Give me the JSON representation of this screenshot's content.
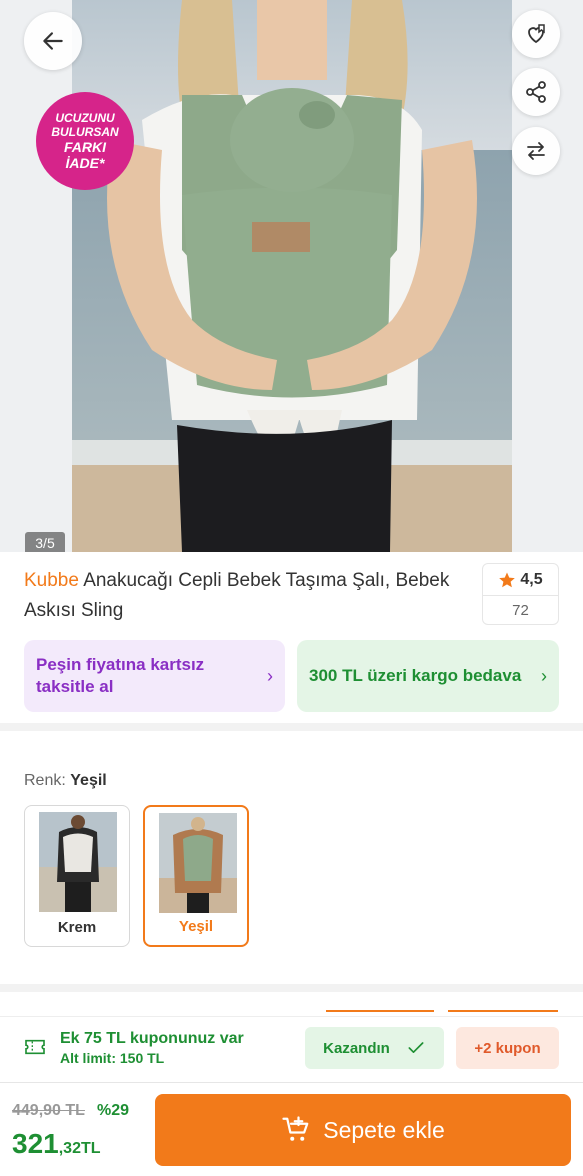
{
  "gallery": {
    "counter": "3/5",
    "badge_lines": [
      "UCUZUNU",
      "BULURSAN",
      "FARKI",
      "İADE*"
    ]
  },
  "product": {
    "brand": "Kubbe",
    "title": "Anakucağı Cepli Bebek Taşıma Şalı, Bebek Askısı Sling",
    "rating": "4,5",
    "review_count": "72"
  },
  "promos": {
    "installment": "Peşin fiyatına kartsız taksitle al",
    "shipping": "300 TL üzeri kargo bedava"
  },
  "color": {
    "label": "Renk:",
    "selected": "Yeşil",
    "options": [
      "Krem",
      "Yeşil"
    ]
  },
  "coupon": {
    "line1": "Ek 75 TL kuponunuz var",
    "line2": "Alt limit: 150 TL",
    "won_label": "Kazandın",
    "extra_label": "+2 kupon"
  },
  "price": {
    "old": "449,90 TL",
    "discount": "%29",
    "current_int": "321",
    "current_dec": ",32TL"
  },
  "cart": {
    "label": "Sepete ekle"
  },
  "colors": {
    "accent": "#f27a1a",
    "green": "#1e8f33",
    "purple": "#8a2fc4",
    "badge": "#d6248a"
  }
}
